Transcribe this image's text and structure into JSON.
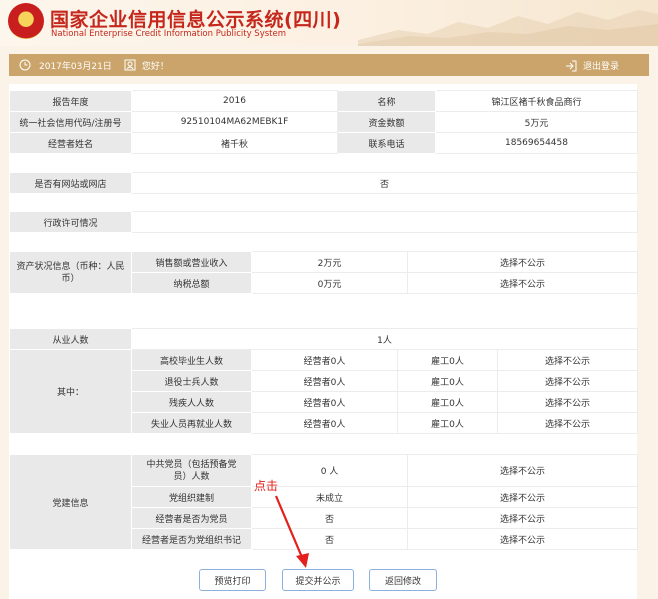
{
  "header": {
    "title_zh": "国家企业信用信息公示系统(四川)",
    "title_en": "National Enterprise Credit Information Publicity System"
  },
  "infobar": {
    "date": "2017年03月21日",
    "greeting": "您好！",
    "logout": "退出登录"
  },
  "basic": {
    "year_label": "报告年度",
    "year_value": "2016",
    "name_label": "名称",
    "name_value": "锦江区褚千秋食品商行",
    "code_label": "统一社会信用代码/注册号",
    "code_value": "92510104MA62MEBK1F",
    "capital_label": "资金数额",
    "capital_value": "5万元",
    "operator_label": "经营者姓名",
    "operator_value": "褚千秋",
    "phone_label": "联系电话",
    "phone_value": "18569654458"
  },
  "website": {
    "label": "是否有网站或网店",
    "value": "否"
  },
  "license": {
    "label": "行政许可情况",
    "value": ""
  },
  "assets": {
    "label": "资产状况信息（币种：人民币）",
    "rows": [
      {
        "item": "销售额或营业收入",
        "value": "2万元",
        "publicity": "选择不公示"
      },
      {
        "item": "纳税总额",
        "value": "0万元",
        "publicity": "选择不公示"
      }
    ]
  },
  "employees": {
    "label": "从业人数",
    "value": "1人",
    "sub_label": "其中：",
    "rows": [
      {
        "item": "高校毕业生人数",
        "operator": "经营者0人",
        "employee": "雇工0人",
        "publicity": "选择不公示"
      },
      {
        "item": "退役士兵人数",
        "operator": "经营者0人",
        "employee": "雇工0人",
        "publicity": "选择不公示"
      },
      {
        "item": "残疾人人数",
        "operator": "经营者0人",
        "employee": "雇工0人",
        "publicity": "选择不公示"
      },
      {
        "item": "失业人员再就业人数",
        "operator": "经营者0人",
        "employee": "雇工0人",
        "publicity": "选择不公示"
      }
    ]
  },
  "party": {
    "label": "党建信息",
    "rows": [
      {
        "item": "中共党员（包括预备党员）人数",
        "value": "0 人",
        "publicity": "选择不公示"
      },
      {
        "item": "党组织建制",
        "value": "未成立",
        "publicity": "选择不公示"
      },
      {
        "item": "经营者是否为党员",
        "value": "否",
        "publicity": "选择不公示"
      },
      {
        "item": "经营者是否为党组织书记",
        "value": "否",
        "publicity": "选择不公示"
      }
    ]
  },
  "annotation": {
    "text": "点击"
  },
  "buttons": {
    "preview": "预览打印",
    "submit": "提交并公示",
    "back": "返回修改"
  },
  "colors": {
    "brand_red": "#c5271c",
    "bar": "#caa46a",
    "label_bg": "#e9e9e9",
    "button_border": "#8cb0de",
    "annotation": "#e3201b"
  }
}
